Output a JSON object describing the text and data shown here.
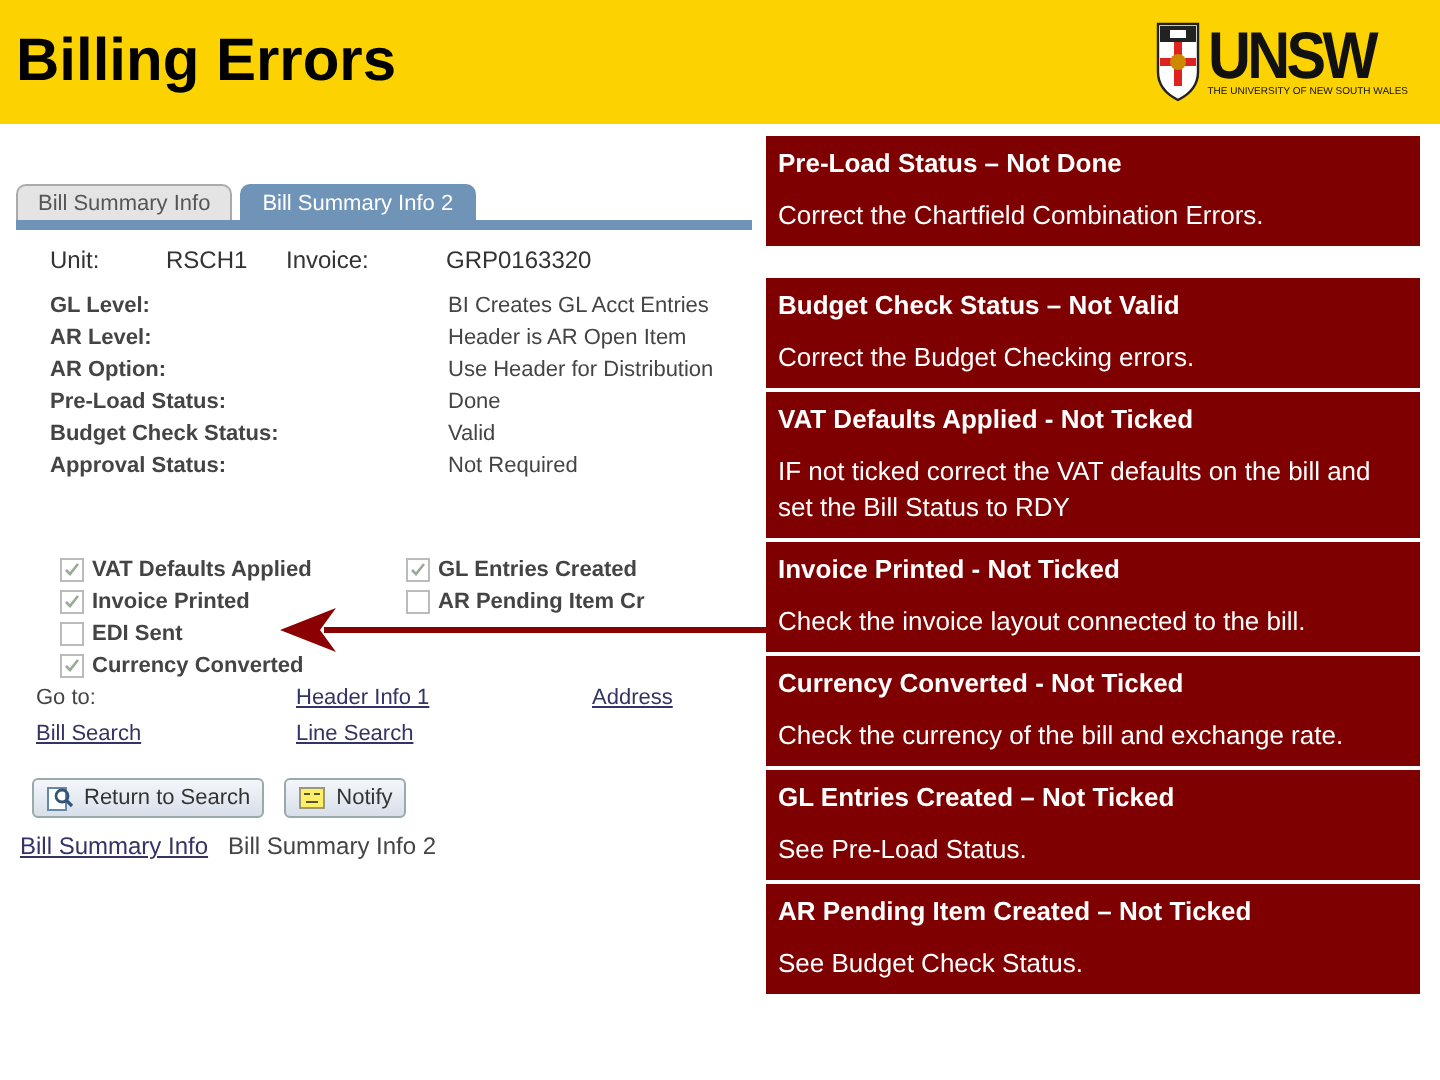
{
  "header": {
    "title": "Billing Errors",
    "logo": {
      "name": "UNSW",
      "subtitle": "THE UNIVERSITY OF NEW SOUTH WALES"
    }
  },
  "screenshot": {
    "tabs": [
      {
        "label": "Bill Summary Info",
        "selected": false
      },
      {
        "label": "Bill Summary Info 2",
        "selected": true
      }
    ],
    "ids": [
      {
        "label": "Unit:",
        "value": "RSCH1"
      },
      {
        "label": "Invoice:",
        "value": "GRP0163320"
      }
    ],
    "fields": [
      {
        "label": "GL Level:",
        "value": "BI Creates GL Acct Entries"
      },
      {
        "label": "AR Level:",
        "value": "Header is AR Open Item"
      },
      {
        "label": "AR Option:",
        "value": "Use Header for Distribution"
      },
      {
        "label": "Pre-Load Status:",
        "value": "Done"
      },
      {
        "label": "Budget Check Status:",
        "value": "Valid"
      },
      {
        "label": "Approval Status:",
        "value": "Not Required"
      }
    ],
    "checkboxes_left": [
      {
        "label": "VAT Defaults Applied",
        "checked": true
      },
      {
        "label": "Invoice Printed",
        "checked": true
      },
      {
        "label": "EDI Sent",
        "checked": false
      },
      {
        "label": "Currency Converted",
        "checked": true
      }
    ],
    "checkboxes_right": [
      {
        "label": "GL Entries Created",
        "checked": true
      },
      {
        "label": "AR Pending Item Cr",
        "checked": false
      }
    ],
    "goto": [
      {
        "kind": "label",
        "text": "Go to:"
      },
      {
        "kind": "link",
        "text": "Header Info 1"
      },
      {
        "kind": "link",
        "text": "Address"
      },
      {
        "kind": "link",
        "text": "Bill Search"
      },
      {
        "kind": "link",
        "text": "Line Search"
      }
    ],
    "buttons": [
      {
        "label": "Return to Search"
      },
      {
        "label": "Notify"
      }
    ],
    "bottom_links": [
      {
        "label": "Bill Summary Info",
        "selected": false
      },
      {
        "label": "Bill Summary Info 2",
        "selected": true
      }
    ]
  },
  "cards": [
    {
      "heading": "Pre-Load Status – Not Done",
      "body": "Correct the Chartfield Combination Errors."
    },
    {
      "heading": "Budget Check Status – Not Valid",
      "body": "Correct the Budget Checking errors."
    },
    {
      "heading": "VAT Defaults Applied - Not Ticked",
      "body": "IF not ticked correct the VAT defaults on the bill and set the Bill Status to RDY"
    },
    {
      "heading": "Invoice Printed - Not Ticked",
      "body": "Check the invoice layout connected to the bill."
    },
    {
      "heading": "Currency Converted - Not Ticked",
      "body": "Check the currency of the bill and exchange rate."
    },
    {
      "heading": "GL Entries Created – Not Ticked",
      "body": "See Pre-Load Status."
    },
    {
      "heading": "AR Pending Item Created – Not Ticked",
      "body": "See Budget Check Status."
    }
  ]
}
